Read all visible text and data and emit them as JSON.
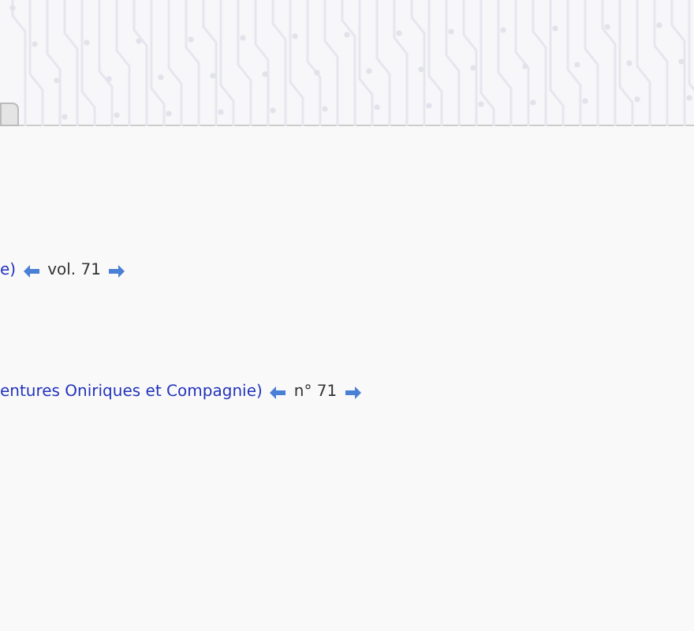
{
  "series_links": [
    {
      "link": "e)",
      "number": "vol. 71"
    },
    {
      "link": "entures Oniriques et Compagnie)",
      "number": "n° 71"
    }
  ]
}
